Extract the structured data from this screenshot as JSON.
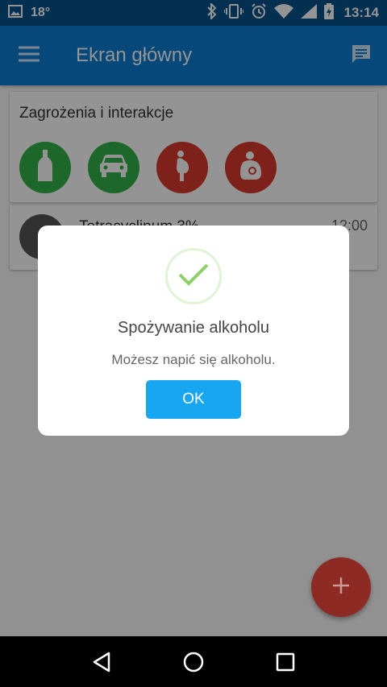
{
  "status_bar": {
    "temperature": "18°",
    "time": "13:14",
    "icons": [
      "image-icon",
      "bluetooth-icon",
      "vibrate-icon",
      "alarm-icon",
      "wifi-icon",
      "signal-icon",
      "battery-icon"
    ]
  },
  "app_bar": {
    "title": "Ekran główny",
    "menu_icon": "menu-icon",
    "chat_icon": "chat-icon",
    "color": "#0a7cd0"
  },
  "threats_card": {
    "title": "Zagrożenia i interakcje",
    "items": [
      {
        "name": "alcohol",
        "icon": "bottle-icon",
        "color": "#33b24b"
      },
      {
        "name": "driving",
        "icon": "car-icon",
        "color": "#33b24b"
      },
      {
        "name": "pregnancy",
        "icon": "pregnant-icon",
        "color": "#d7392e"
      },
      {
        "name": "breastfeeding",
        "icon": "breastfeeding-icon",
        "color": "#d7392e"
      }
    ]
  },
  "medication_card": {
    "name": "Tetracyclinum 3%",
    "time": "12:00"
  },
  "dialog": {
    "icon": "check-icon",
    "title": "Spożywanie alkoholu",
    "message": "Możesz napić się alkoholu.",
    "ok_label": "OK",
    "button_color": "#19a6f0"
  },
  "fab": {
    "icon": "plus-icon",
    "color": "#d7392e"
  },
  "nav_bar": {
    "icons": [
      "back-icon",
      "home-icon",
      "recents-icon"
    ]
  }
}
